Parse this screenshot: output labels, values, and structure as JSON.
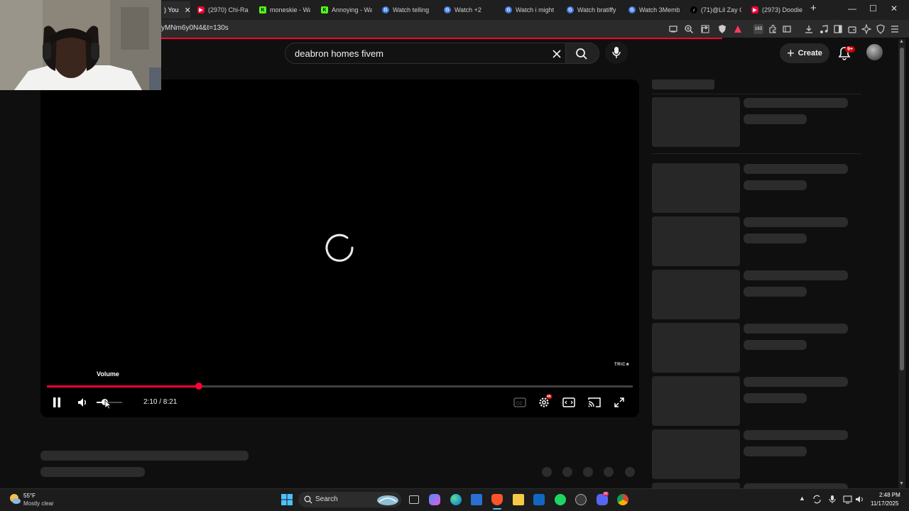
{
  "browser": {
    "tabs": [
      {
        "label": ") You",
        "icon": "youtube-icon",
        "active": true
      },
      {
        "label": "(2970) Chi-Raq",
        "icon": "youtube-icon"
      },
      {
        "label": "moneskie - Wa",
        "icon": "kick-icon"
      },
      {
        "label": "Annoying - Wa",
        "icon": "kick-icon"
      },
      {
        "label": "Watch telling",
        "icon": "globe-icon"
      },
      {
        "label": "Watch +2",
        "icon": "globe-icon"
      },
      {
        "label": "Watch i might",
        "icon": "globe-icon"
      },
      {
        "label": "Watch bratiffy",
        "icon": "globe-icon"
      },
      {
        "label": "Watch 3Memb",
        "icon": "globe-icon"
      },
      {
        "label": "(71)@Lil Zay O",
        "icon": "tiktok-icon"
      },
      {
        "label": "(2973) Doodie",
        "icon": "youtube-icon"
      }
    ],
    "new_tab_label": "+",
    "url": "yMNm6y0N4&t=130s",
    "extension_badge": "163"
  },
  "youtube": {
    "search_value": "deabron homes fivem",
    "create_label": "Create",
    "notification_badge": "9+"
  },
  "player": {
    "volume_tooltip": "Volume",
    "time_display": "2:10 / 8:21",
    "progress_fraction": 0.259,
    "volume_fraction": 0.3,
    "watermark": "TRIC★",
    "settings_badge": "4K",
    "accent_color": "#ff0033"
  },
  "taskbar": {
    "weather_temp": "55°F",
    "weather_desc": "Mostly clear",
    "search_label": "Search",
    "chat_badge": "99",
    "time": "2:48 PM",
    "date": "11/17/2025"
  }
}
